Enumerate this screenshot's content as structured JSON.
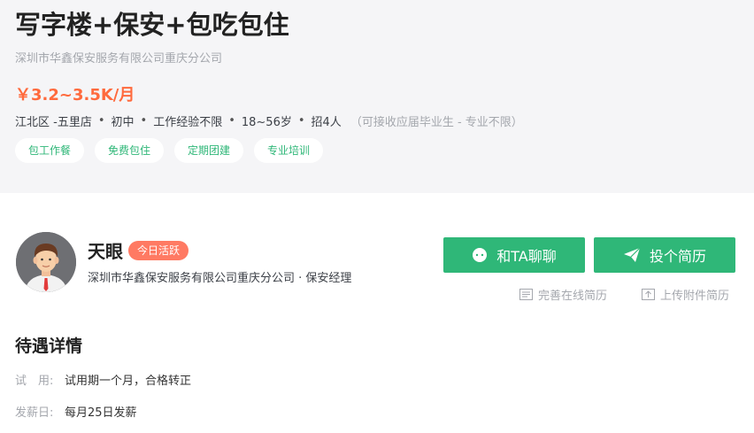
{
  "job": {
    "title": "写字楼+保安+包吃包住",
    "company": "深圳市华鑫保安服务有限公司重庆分公司",
    "salary": "￥3.2~3.5K/月",
    "info": {
      "location": "江北区 -五里店",
      "education": "初中",
      "experience": "工作经验不限",
      "age": "18~56岁",
      "headcount": "招4人",
      "note": "（可接收应届毕业生 - 专业不限）"
    },
    "tags": [
      "包工作餐",
      "免费包住",
      "定期团建",
      "专业培训"
    ]
  },
  "recruiter": {
    "name": "天眼",
    "status": "今日活跃",
    "company_role": "深圳市华鑫保安服务有限公司重庆分公司 · 保安经理"
  },
  "actions": {
    "chat_label": "和TA聊聊",
    "resume_label": "投个简历",
    "online_resume": "完善在线简历",
    "upload_resume": "上传附件简历"
  },
  "benefits": {
    "title": "待遇详情",
    "rows": [
      {
        "label": "试　用:",
        "value": "试用期一个月，合格转正"
      },
      {
        "label": "发薪日:",
        "value": "每月25日发薪"
      }
    ]
  },
  "colors": {
    "accent": "#2fb778",
    "salary": "#ff6a3d",
    "badge": "#ff7a63",
    "muted": "#a4a7ad"
  }
}
